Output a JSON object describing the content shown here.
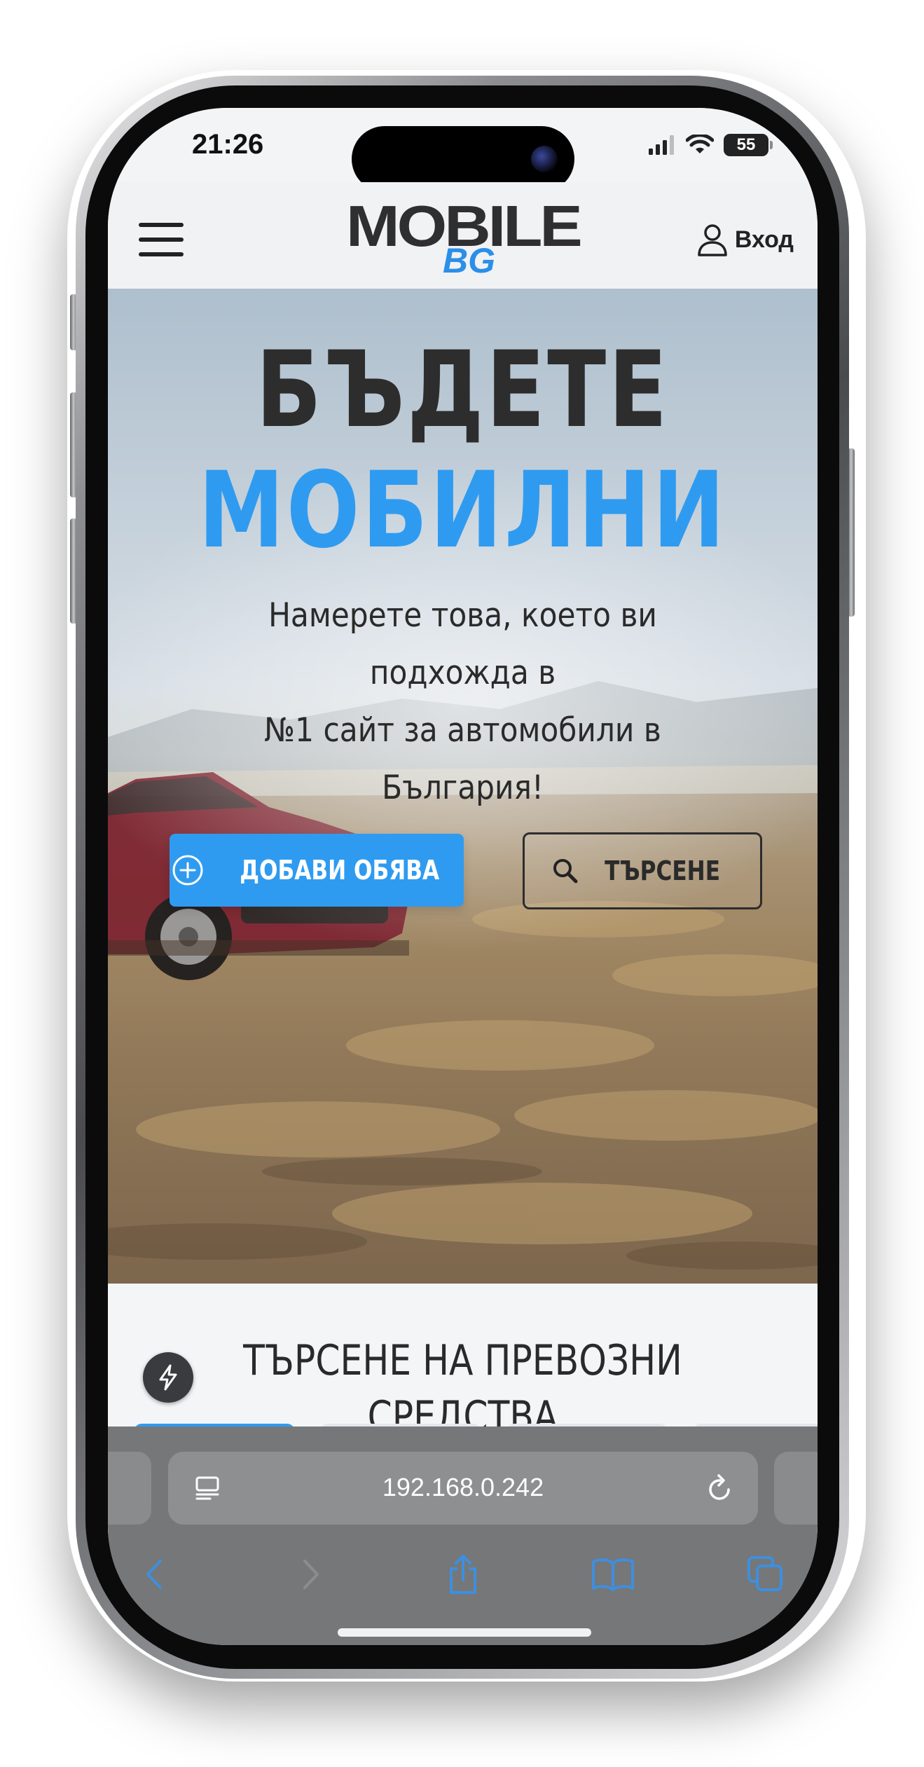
{
  "status_bar": {
    "time": "21:26",
    "battery": "55",
    "icons": [
      "cellular-signal-icon",
      "wifi-icon",
      "battery-icon"
    ]
  },
  "header": {
    "logo_main": "MOBILE",
    "logo_sub": "BG",
    "login_label": "Вход",
    "icons": [
      "menu-icon",
      "user-icon"
    ]
  },
  "hero": {
    "title_line1": "БЪДЕТЕ",
    "title_line2": "МОБИЛНИ",
    "subtitle_line1": "Намерете това, което ви подхожда в",
    "subtitle_line2": "№1 сайт за автомобили в България!",
    "add_button_label": "ДОБАВИ ОБЯВА",
    "search_button_label": "ТЪРСЕНЕ",
    "icons": [
      "plus-circle-icon",
      "search-icon"
    ]
  },
  "vehicle_search": {
    "title": "ТЪРСЕНЕ НА ПРЕВОЗНИ СРЕДСТВА",
    "categories": [
      {
        "icon": "car-icon",
        "active": true
      },
      {
        "icon": "van-icon",
        "active": false
      },
      {
        "icon": "motorcycle-icon",
        "active": false
      },
      {
        "icon": "truck-icon",
        "active": false
      }
    ]
  },
  "browser": {
    "url": "192.168.0.242",
    "icons": [
      "reader-icon",
      "reload-icon",
      "back-icon",
      "forward-icon",
      "share-icon",
      "bookmarks-icon",
      "tabs-icon",
      "bolt-icon"
    ]
  },
  "colors": {
    "accent": "#2f9bf0",
    "dark_text": "#2d2d2d",
    "browser_bar": "#767778",
    "toolbar_icon": "#3d8fe0"
  }
}
